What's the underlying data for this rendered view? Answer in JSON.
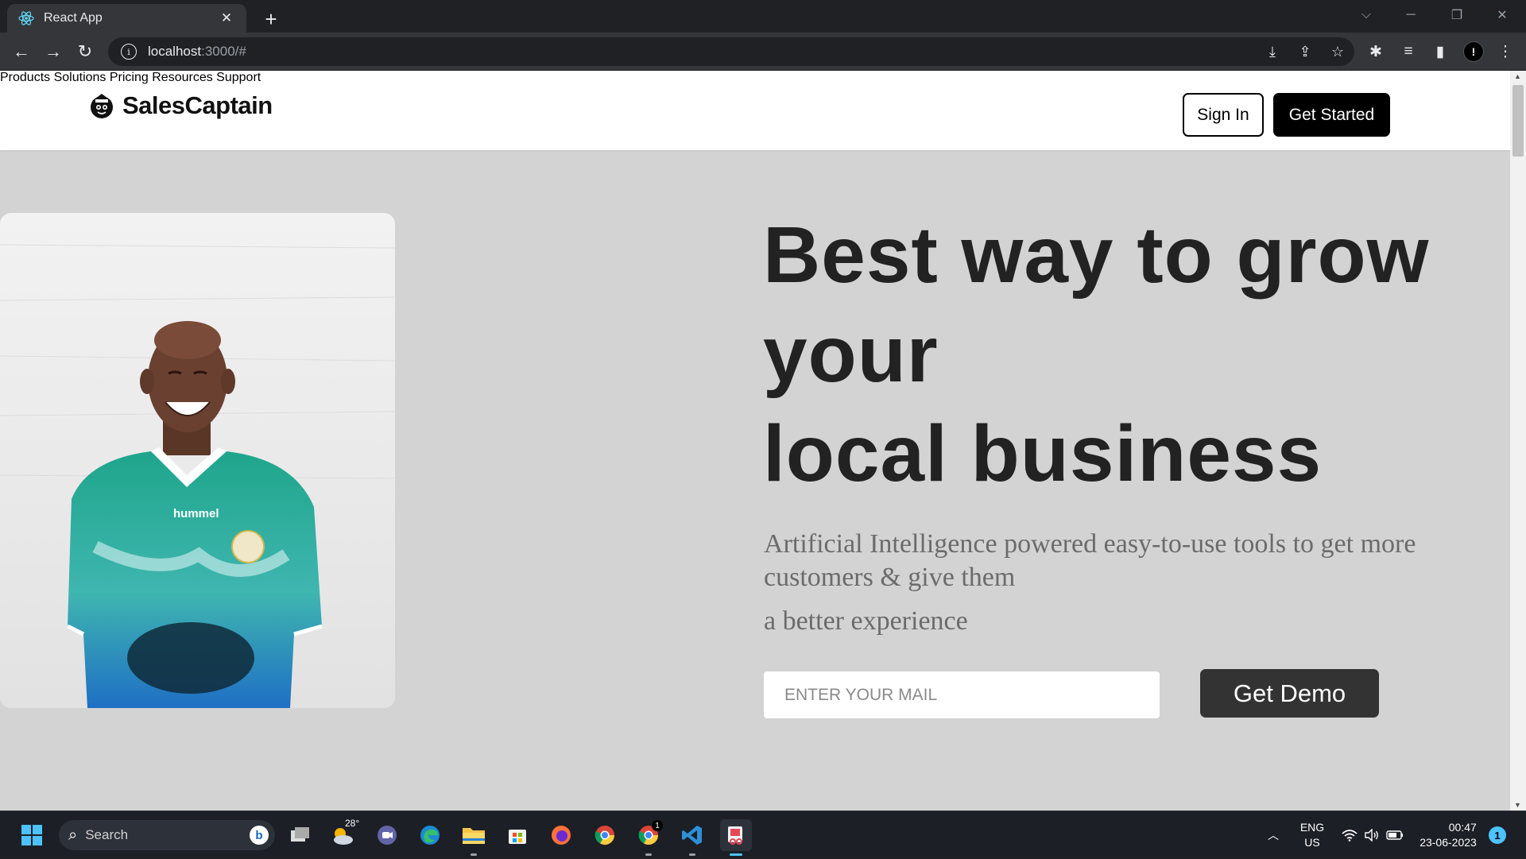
{
  "browser": {
    "tab_title": "React App",
    "url_host": "localhost",
    "url_path": ":3000/#"
  },
  "site": {
    "brand": "SalesCaptain",
    "nav": [
      "Products",
      "Solutions",
      "Pricing",
      "Resources",
      "Support"
    ],
    "sign_in_label": "Sign In",
    "get_started_label": "Get Started"
  },
  "hero": {
    "headline_lines": [
      "Best way to grow",
      "your",
      "local business"
    ],
    "subtitle": "Artificial Intelligence powered easy-to-use tools to get more customers & give them",
    "subtitle_line2": "a better experience",
    "email_placeholder": "ENTER YOUR MAIL",
    "demo_label": "Get Demo",
    "photo_shirt_text": "hummel"
  },
  "taskbar": {
    "search_label": "Search",
    "weather_temp": "28°",
    "chrome_badge": "1",
    "lang_line1": "ENG",
    "lang_line2": "US",
    "time": "00:47",
    "date": "23-06-2023",
    "notification_count": "1"
  }
}
